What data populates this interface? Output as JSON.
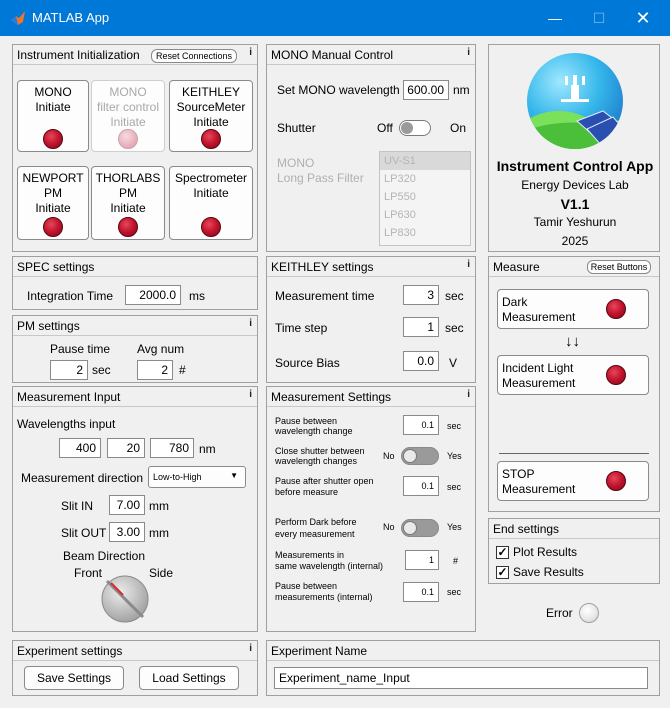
{
  "window": {
    "title": "MATLAB App",
    "minimize_icon": "minimize-icon",
    "maximize_icon": "maximize-icon",
    "close_icon": "close-icon"
  },
  "instrument_init": {
    "title": "Instrument Initialization",
    "reset_label": "Reset Connections",
    "info": "i",
    "buttons": [
      {
        "line1": "MONO",
        "line2": "Initiate",
        "line3": "",
        "state": "on"
      },
      {
        "line1": "MONO",
        "line2": "filter control",
        "line3": "Initiate",
        "state": "disabled"
      },
      {
        "line1": "KEITHLEY",
        "line2": "SourceMeter",
        "line3": "Initiate",
        "state": "on"
      },
      {
        "line1": "NEWPORT",
        "line2": "PM",
        "line3": "Initiate",
        "state": "on"
      },
      {
        "line1": "THORLABS",
        "line2": "PM",
        "line3": "Initiate",
        "state": "on"
      },
      {
        "line1": "Spectrometer",
        "line2": "Initiate",
        "line3": "",
        "state": "on"
      }
    ]
  },
  "mono_manual": {
    "title": "MONO Manual Control",
    "info": "i",
    "wavelength_label": "Set MONO wavelength",
    "wavelength_value": "600.00",
    "wavelength_unit": "nm",
    "shutter_label": "Shutter",
    "shutter_off": "Off",
    "shutter_on": "On",
    "filter_label_1": "MONO",
    "filter_label_2": "Long Pass Filter",
    "filters": [
      "UV-S1",
      "LP320",
      "LP550",
      "LP630",
      "LP830"
    ]
  },
  "about": {
    "app_name": "Instrument Control App",
    "lab": "Energy Devices Lab",
    "version": "V1.1",
    "author": "Tamir Yeshurun",
    "year": "2025"
  },
  "spec": {
    "title": "SPEC settings",
    "label": "Integration Time",
    "value": "2000.0",
    "unit": "ms"
  },
  "pm": {
    "title": "PM settings",
    "info": "i",
    "pause_label": "Pause time",
    "pause_value": "2",
    "pause_unit": "sec",
    "avg_label": "Avg num",
    "avg_value": "2",
    "avg_unit": "#"
  },
  "keithley": {
    "title": "KEITHLEY settings",
    "info": "i",
    "meas_time_label": "Measurement time",
    "meas_time_value": "3",
    "meas_time_unit": "sec",
    "time_step_label": "Time step",
    "time_step_value": "1",
    "time_step_unit": "sec",
    "bias_label": "Source Bias",
    "bias_value": "0.0",
    "bias_unit": "V"
  },
  "measure": {
    "title": "Measure",
    "reset_label": "Reset Buttons",
    "dark_1": "Dark",
    "dark_2": "Measurement",
    "arrows": "↓↓",
    "incident_1": "Incident Light",
    "incident_2": "Measurement",
    "stop_1": "STOP",
    "stop_2": "Measurement"
  },
  "meas_input": {
    "title": "Measurement Input",
    "info": "i",
    "wl_label": "Wavelengths input",
    "wl_start": "400",
    "wl_step": "20",
    "wl_end": "780",
    "wl_unit": "nm",
    "direction_label": "Measurement direction",
    "direction_value": "Low-to-High",
    "slit_in_label": "Slit IN",
    "slit_in_value": "7.00",
    "slit_in_unit": "mm",
    "slit_out_label": "Slit OUT",
    "slit_out_value": "3.00",
    "slit_out_unit": "mm",
    "beam_label": "Beam Direction",
    "beam_front": "Front",
    "beam_side": "Side"
  },
  "meas_settings": {
    "title": "Measurement Settings",
    "info": "i",
    "pause_wl_1": "Pause between",
    "pause_wl_2": "wavelength change",
    "pause_wl_value": "0.1",
    "pause_wl_unit": "sec",
    "close_1": "Close shutter between",
    "close_2": "wavelength changes",
    "close_no": "No",
    "close_yes": "Yes",
    "after_1": "Pause after shutter open",
    "after_2": "before measure",
    "after_value": "0.1",
    "after_unit": "sec",
    "dark_1": "Perform Dark before",
    "dark_2": "every measurement",
    "dark_no": "No",
    "dark_yes": "Yes",
    "same_1": "Measurements in",
    "same_2": "same wavelength (internal)",
    "same_value": "1",
    "same_unit": "#",
    "pause_int_1": "Pause between",
    "pause_int_2": "measurements (internal)",
    "pause_int_value": "0.1",
    "pause_int_unit": "sec"
  },
  "end_settings": {
    "title": "End settings",
    "plot_label": "Plot Results",
    "save_label": "Save Results",
    "check": "✓"
  },
  "error": {
    "label": "Error"
  },
  "exp_settings": {
    "title": "Experiment settings",
    "info": "i",
    "save_label": "Save Settings",
    "load_label": "Load Settings"
  },
  "exp_name": {
    "title": "Experiment Name",
    "value": "Experiment_name_Input"
  }
}
